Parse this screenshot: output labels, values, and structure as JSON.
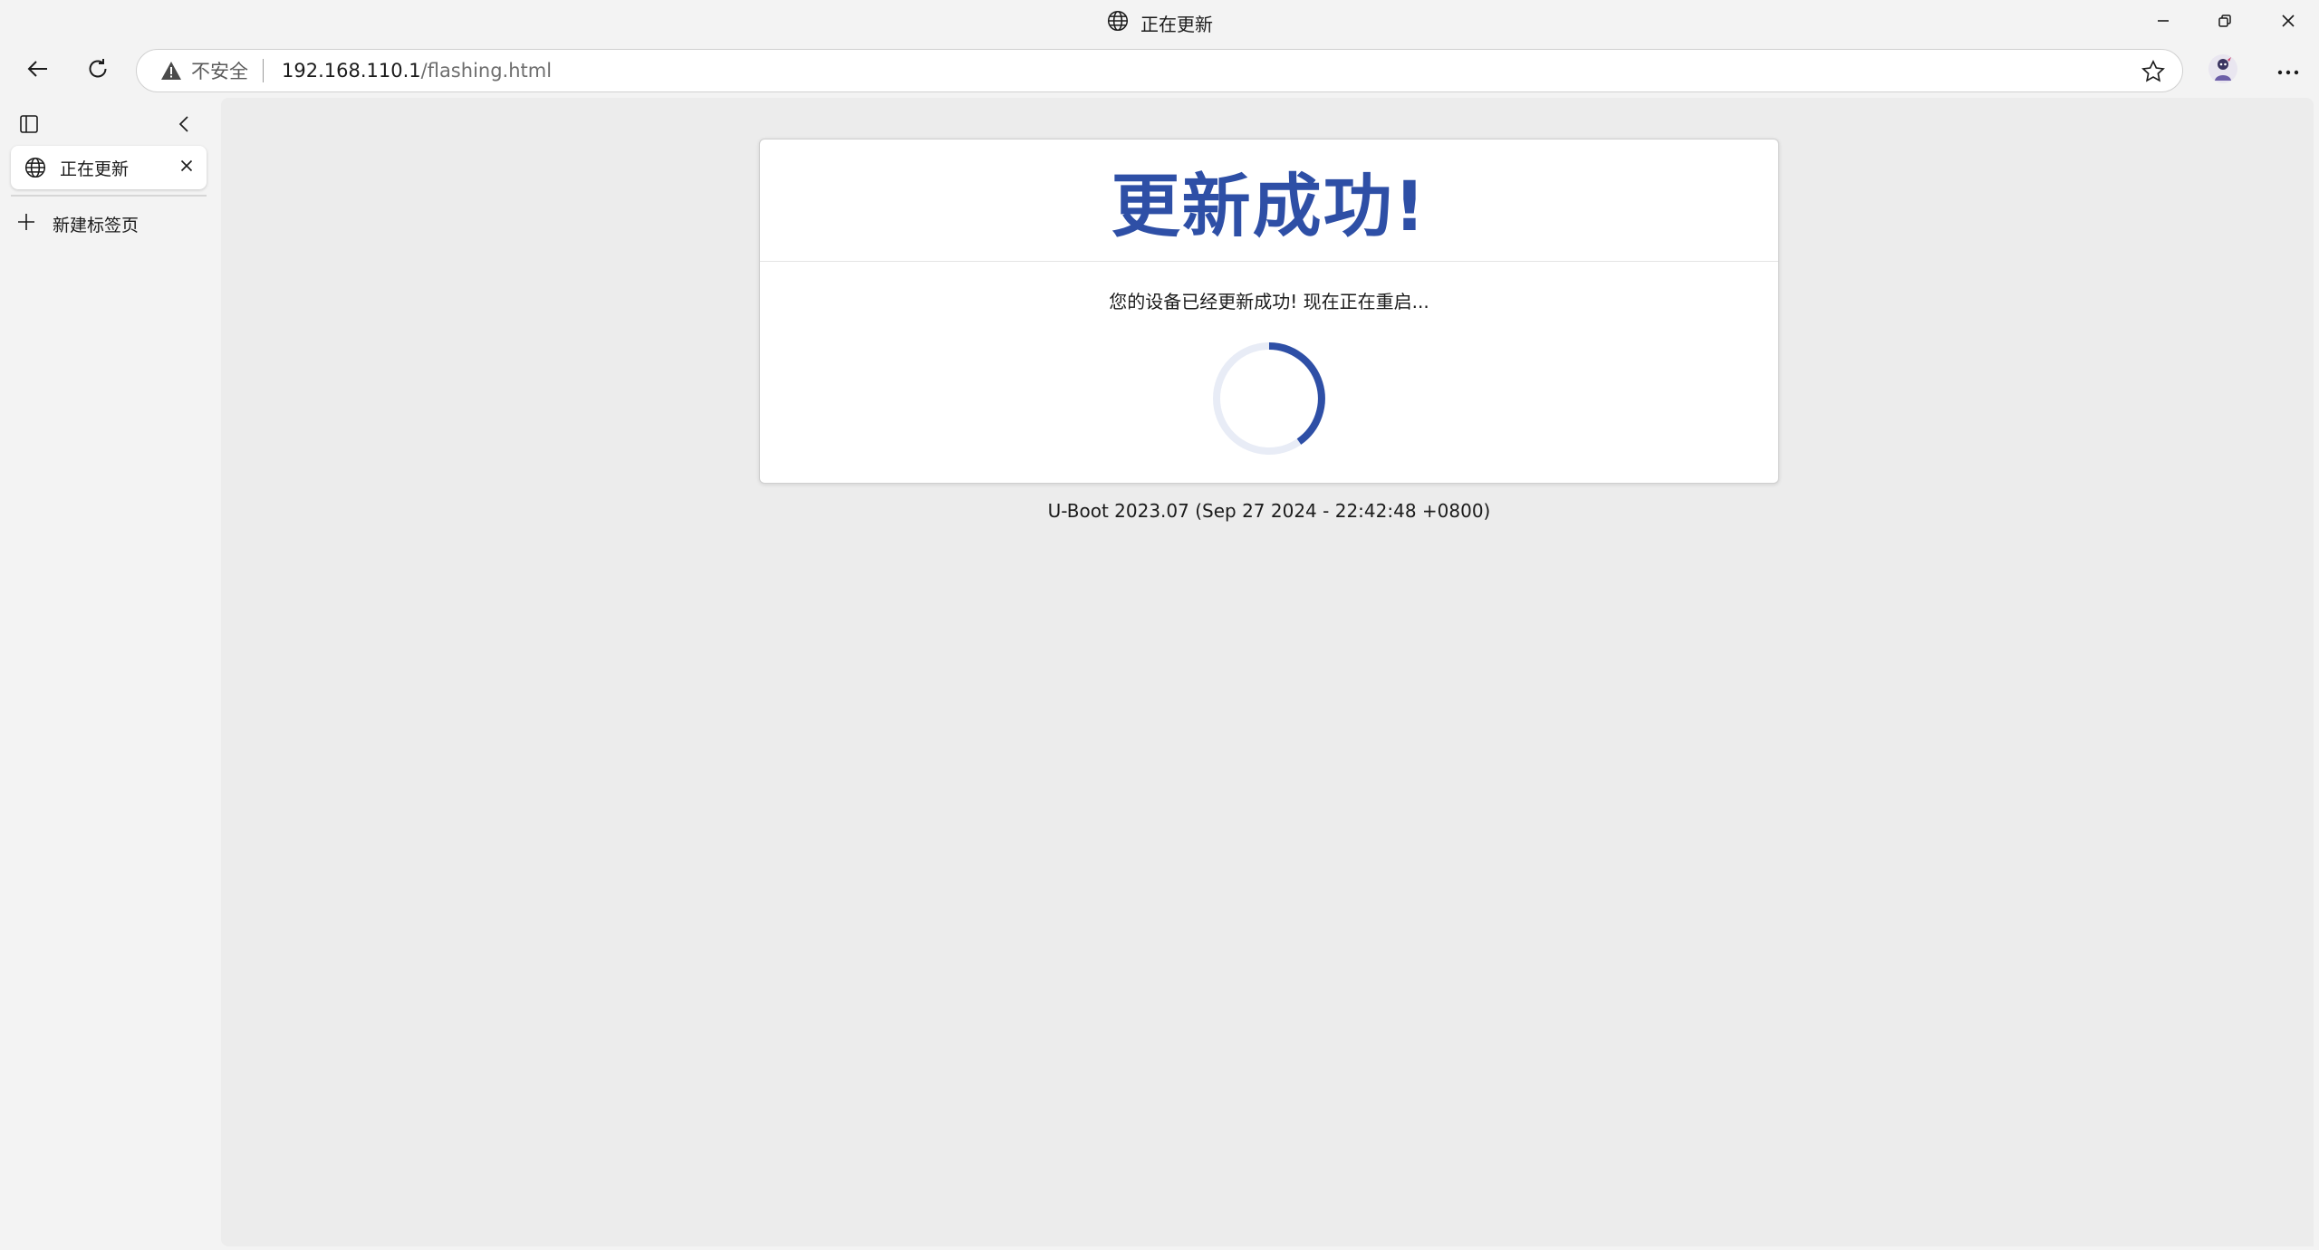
{
  "window": {
    "title": "正在更新",
    "minimize_icon": "minimize-icon",
    "restore_icon": "restore-icon",
    "close_icon": "close-icon"
  },
  "toolbar": {
    "back_icon": "back-arrow-icon",
    "refresh_icon": "refresh-icon",
    "security_label": "不安全",
    "url_host": "192.168.110.1",
    "url_path": "/flashing.html",
    "favorite_icon": "star-icon",
    "more_icon": "more-icon"
  },
  "sidebar": {
    "tabs": [
      {
        "label": "正在更新",
        "icon": "globe-icon",
        "active": true
      }
    ],
    "new_tab_label": "新建标签页"
  },
  "page": {
    "heading": "更新成功!",
    "message": "您的设备已经更新成功! 现在正在重启...",
    "footer": "U-Boot 2023.07 (Sep 27 2024 - 22:42:48 +0800)"
  },
  "colors": {
    "accent": "#2e4fa6",
    "spinner_track": "#e8ecf6",
    "content_bg": "#ececec",
    "chrome_bg": "#f3f3f3"
  }
}
